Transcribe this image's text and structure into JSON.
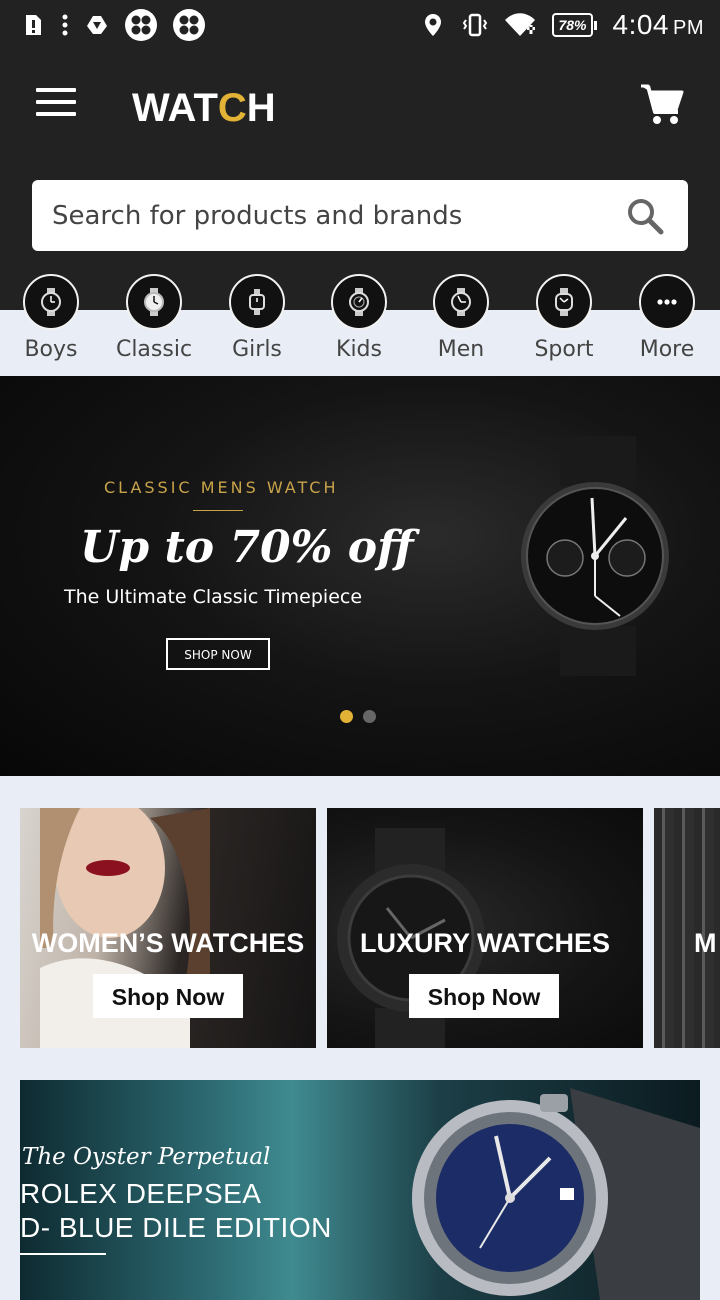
{
  "status_bar": {
    "time": "4:04",
    "ampm": "PM",
    "battery": "78%",
    "icons": [
      "alert-icon",
      "more-vert-icon",
      "drive-icon",
      "clover-icon",
      "clover-icon",
      "location-icon",
      "vibrate-icon",
      "wifi-icon",
      "battery-icon"
    ]
  },
  "header": {
    "logo": {
      "part1": "WAT",
      "part2": "C",
      "part3": "H"
    },
    "menu_icon": "menu-icon",
    "cart_icon": "cart-icon",
    "search": {
      "placeholder": "Search for products and brands",
      "icon": "search-icon"
    }
  },
  "categories": [
    {
      "label": "Boys",
      "icon": "watch-icon"
    },
    {
      "label": "Classic",
      "icon": "watch-icon"
    },
    {
      "label": "Girls",
      "icon": "watch-icon"
    },
    {
      "label": "Kids",
      "icon": "watch-icon"
    },
    {
      "label": "Men",
      "icon": "watch-icon"
    },
    {
      "label": "Sport",
      "icon": "watch-icon"
    },
    {
      "label": "More",
      "icon": "more-horiz-icon"
    }
  ],
  "hero": {
    "eyebrow": "CLASSIC MENS WATCH",
    "headline": "Up to 70% off",
    "subline": "The Ultimate Classic Timepiece",
    "cta": "SHOP NOW",
    "dots": {
      "count": 2,
      "active": 0
    }
  },
  "promos": [
    {
      "title": "WOMEN’S WATCHES",
      "cta": "Shop Now"
    },
    {
      "title": "LUXURY WATCHES",
      "cta": "Shop Now"
    },
    {
      "title": "M",
      "cta": ""
    }
  ],
  "feature_banner": {
    "line1": "The Oyster Perpetual",
    "line2": "ROLEX DEEPSEA",
    "line3": "D- BLUE DILE EDITION"
  },
  "colors": {
    "header_bg": "#222222",
    "page_bg": "#e9eef6",
    "accent_gold": "#e2b236",
    "dot_active": "#e2b236",
    "dot_inactive": "#666666"
  }
}
